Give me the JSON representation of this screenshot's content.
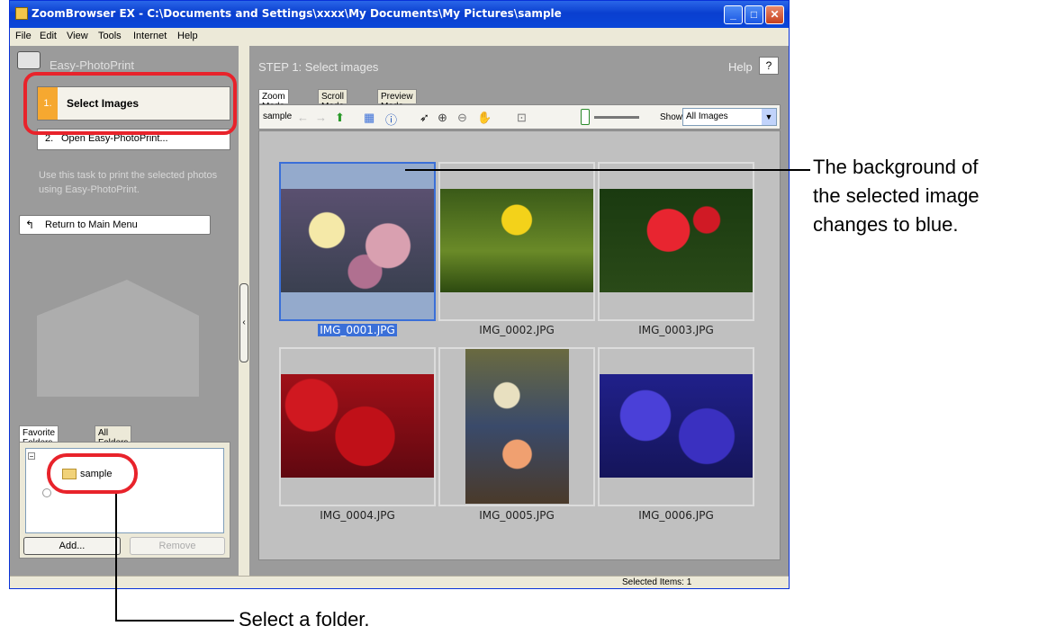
{
  "window": {
    "title": "ZoomBrowser EX  -  C:\\Documents and Settings\\xxxx\\My Documents\\My Pictures\\sample"
  },
  "menubar": [
    "File",
    "Edit",
    "View",
    "Tools",
    "Internet",
    "Help"
  ],
  "left_panel": {
    "header": "Easy-PhotoPrint",
    "steps": [
      {
        "num": "1.",
        "label": "Select Images"
      },
      {
        "num": "2.",
        "label": "Open Easy-PhotoPrint..."
      }
    ],
    "hint": "Use this task to print the selected photos using Easy-PhotoPrint.",
    "return_button": "Return to Main Menu"
  },
  "folders": {
    "tabs": [
      "Favorite Folders",
      "All Folders"
    ],
    "tree_item": "sample",
    "add_button": "Add...",
    "remove_button": "Remove"
  },
  "main": {
    "step_title": "STEP 1: Select images",
    "help_label": "Help",
    "help_button": "?",
    "tabs": [
      "Zoom Mode",
      "Scroll Mode",
      "Preview Mode"
    ],
    "toolbar": {
      "folder": "sample",
      "show_label": "Show",
      "show_value": "All Images"
    },
    "images": [
      {
        "name": "IMG_0001.JPG",
        "selected": true
      },
      {
        "name": "IMG_0002.JPG",
        "selected": false
      },
      {
        "name": "IMG_0003.JPG",
        "selected": false
      },
      {
        "name": "IMG_0004.JPG",
        "selected": false
      },
      {
        "name": "IMG_0005.JPG",
        "selected": false
      },
      {
        "name": "IMG_0006.JPG",
        "selected": false
      }
    ]
  },
  "status": {
    "text": "Selected Items: 1"
  },
  "annotations": {
    "selected_bg": [
      "The background of",
      "the selected image",
      "changes to blue."
    ],
    "select_folder": "Select a folder."
  },
  "colors": {
    "highlight": "#e8232b",
    "selection": "#3a6fd8"
  }
}
